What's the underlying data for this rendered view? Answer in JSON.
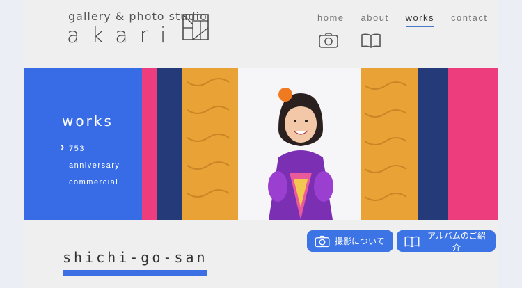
{
  "brand": {
    "subtitle": "gallery & photo studio",
    "name": "akari"
  },
  "nav": {
    "items": [
      {
        "label": "home"
      },
      {
        "label": "about"
      },
      {
        "label": "works"
      },
      {
        "label": "contact"
      }
    ],
    "active": "works"
  },
  "icons": {
    "camera": "camera-icon",
    "album": "book-icon"
  },
  "hero": {
    "title": "works",
    "menu": [
      "753",
      "anniversary",
      "commercial"
    ],
    "current": "753"
  },
  "buttons": {
    "about_shooting": "撮影について",
    "album_intro": "アルバムのご紹介"
  },
  "section": {
    "title": "shichi-go-san"
  },
  "colors": {
    "accent": "#3c74e6",
    "background": "#efefef"
  }
}
